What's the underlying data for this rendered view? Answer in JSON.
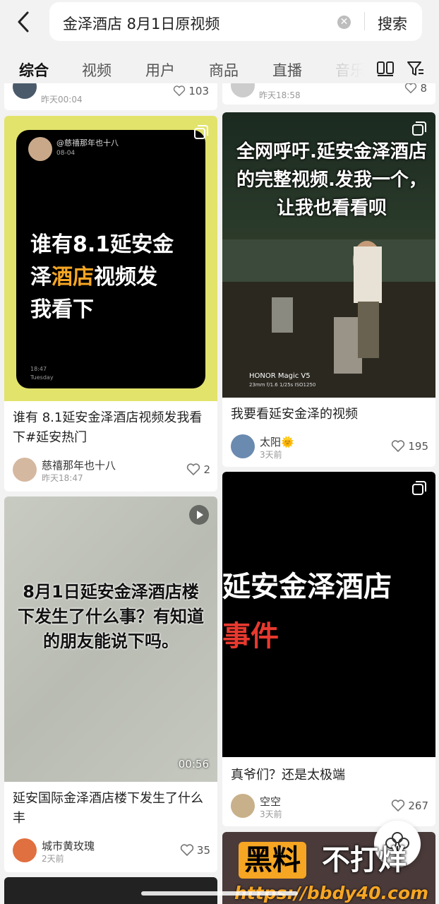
{
  "search": {
    "query": "金泽酒店 8月1日原视频",
    "clear_icon": "clear-icon",
    "button_label": "搜索"
  },
  "tabs": [
    "综合",
    "视频",
    "用户",
    "商品",
    "直播",
    "音乐"
  ],
  "top_partial": {
    "left_time": "昨天00:04",
    "left_likes": "103",
    "right_time": "昨天18:58",
    "right_likes": "8"
  },
  "cards": {
    "c1": {
      "note_user": "@慈禧那年也十八",
      "note_date": "08-04",
      "note_text_before": "谁有8.1延安金",
      "note_text_mid_1": "泽",
      "note_text_highlight": "酒店",
      "note_text_mid_2": "视频发",
      "note_text_after": "我看下",
      "note_time": "18:47",
      "note_day": "Tuesday",
      "title": "谁有 8.1延安金泽酒店视频发我看下#延安热门",
      "author": "慈禧那年也十八",
      "time": "昨天18:47",
      "likes": "2"
    },
    "c2": {
      "overlay": "全网呼吁.延安金泽酒店的完整视频.发我一个，让我也看看呗",
      "camera_brand": "HONOR Magic V5",
      "camera_specs": "23mm f/1.6 1/25s ISO1250",
      "title": "我要看延安金泽的视频",
      "author": "太阳🌞",
      "time": "3天前",
      "likes": "195"
    },
    "c3": {
      "overlay": "8月1日延安金泽酒店楼下发生了什么事？有知道的朋友能说下吗。",
      "duration": "00:56",
      "title": "延安国际金泽酒店楼下发生了什么丰",
      "author": "城市黄玫瑰",
      "time": "2天前",
      "likes": "35"
    },
    "c4": {
      "overlay_line1": "延安金泽酒店",
      "overlay_line2": "事件",
      "title": "真爷们？还是太极端",
      "author": "空空",
      "time": "3天前",
      "likes": "267"
    }
  },
  "watermark": {
    "brand_1": "黑料",
    "brand_2": "不打烊",
    "url": "https://bbdy40.com"
  },
  "colors": {
    "accent_yellow": "#e2e36b",
    "highlight_orange": "#f6a623",
    "event_red": "#e8392f"
  }
}
